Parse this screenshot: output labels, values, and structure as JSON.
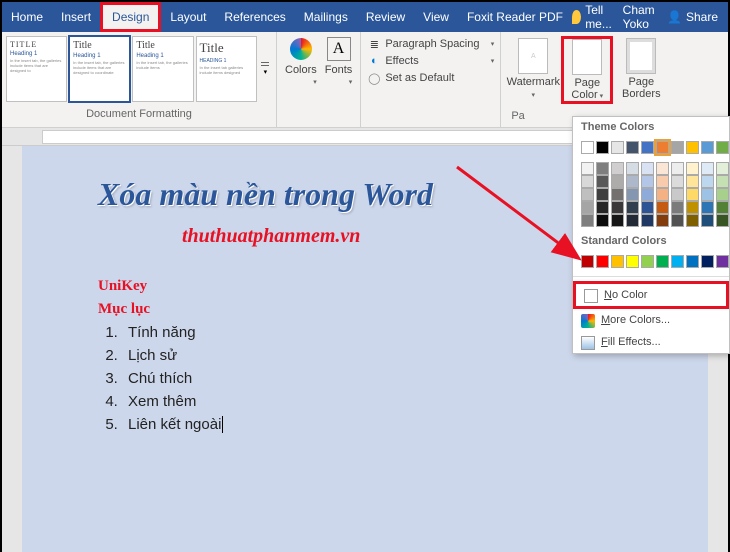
{
  "tabs": [
    "Home",
    "Insert",
    "Design",
    "Layout",
    "References",
    "Mailings",
    "Review",
    "View",
    "Foxit Reader PDF"
  ],
  "active_tab": "Design",
  "tell_me": "Tell me...",
  "user": "Cham Yoko",
  "share": "Share",
  "thumbs": [
    {
      "title": "TITLE",
      "h1": "Heading 1"
    },
    {
      "title": "Title",
      "h1": "Heading 1"
    },
    {
      "title": "Title",
      "h1": "Heading 1"
    },
    {
      "title": "Title",
      "h1": "HEADING 1"
    }
  ],
  "grp_doc_format": "Document Formatting",
  "colors_label": "Colors",
  "fonts_label": "Fonts",
  "para_spacing": "Paragraph Spacing",
  "effects": "Effects",
  "set_default": "Set as Default",
  "watermark": "Watermark",
  "page_color": "Page Color",
  "page_borders": "Page Borders",
  "grp_page_bg": "Pa",
  "dropdown": {
    "theme_colors": "Theme Colors",
    "standard_colors": "Standard Colors",
    "no_color": "No Color",
    "more_colors": "More Colors...",
    "fill_effects": "Fill Effects..."
  },
  "theme_palette_row1": [
    "#ffffff",
    "#000000",
    "#e7e6e6",
    "#44546a",
    "#4472c4",
    "#ed7d31",
    "#a5a5a5",
    "#ffc000",
    "#5b9bd5",
    "#70ad47"
  ],
  "theme_palette_rows": [
    [
      "#f2f2f2",
      "#7f7f7f",
      "#d0cece",
      "#d6dce4",
      "#d9e2f3",
      "#fbe5d5",
      "#ededed",
      "#fff2cc",
      "#deebf6",
      "#e2efd9"
    ],
    [
      "#d8d8d8",
      "#595959",
      "#aeabab",
      "#adb9ca",
      "#b4c6e7",
      "#f7cbac",
      "#dbdbdb",
      "#fee599",
      "#bdd7ee",
      "#c5e0b3"
    ],
    [
      "#bfbfbf",
      "#3f3f3f",
      "#757070",
      "#8496b0",
      "#8eaadb",
      "#f4b183",
      "#c9c9c9",
      "#ffd965",
      "#9cc3e5",
      "#a8d08d"
    ],
    [
      "#a5a5a5",
      "#262626",
      "#3a3838",
      "#323f4f",
      "#2f5496",
      "#c55a11",
      "#7b7b7b",
      "#bf9000",
      "#2e75b5",
      "#538135"
    ],
    [
      "#7f7f7f",
      "#0c0c0c",
      "#171616",
      "#222a35",
      "#1f3864",
      "#833c0b",
      "#525252",
      "#7f6000",
      "#1e4e79",
      "#375623"
    ]
  ],
  "standard_palette": [
    "#c00000",
    "#ff0000",
    "#ffc000",
    "#ffff00",
    "#92d050",
    "#00b050",
    "#00b0f0",
    "#0070c0",
    "#002060",
    "#7030a0"
  ],
  "doc": {
    "title": "Xóa màu nền trong Word",
    "sub": "thuthuatphanmem.vn",
    "h1": "UniKey",
    "h2": "Mục lục",
    "items": [
      "Tính năng",
      "Lịch sử",
      "Chú thích",
      "Xem thêm",
      "Liên kết ngoài"
    ]
  }
}
